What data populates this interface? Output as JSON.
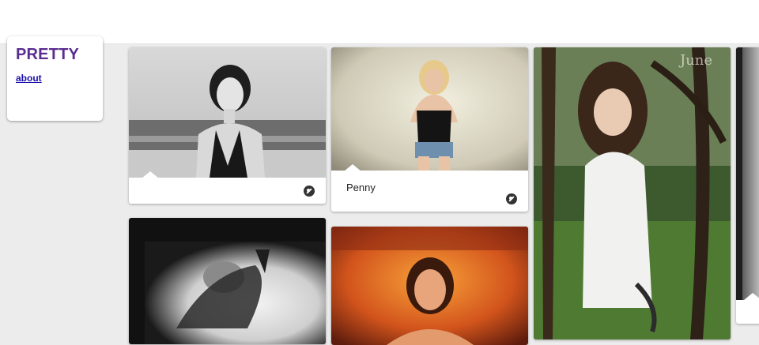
{
  "header": {
    "site_title": "PRETTY",
    "about_link": "about"
  },
  "pins": [
    {
      "id": "beach-portrait",
      "caption": ""
    },
    {
      "id": "penny",
      "caption": "Penny"
    },
    {
      "id": "forest-portrait",
      "caption": ""
    },
    {
      "id": "bw-dancer",
      "caption": ""
    },
    {
      "id": "orange-portrait",
      "caption": ""
    },
    {
      "id": "partial-right",
      "caption": ""
    }
  ],
  "icons": {
    "pin_action": "wrench-icon"
  },
  "colors": {
    "title": "#5a2d91",
    "link": "#1a0dab",
    "background": "#ececec"
  }
}
